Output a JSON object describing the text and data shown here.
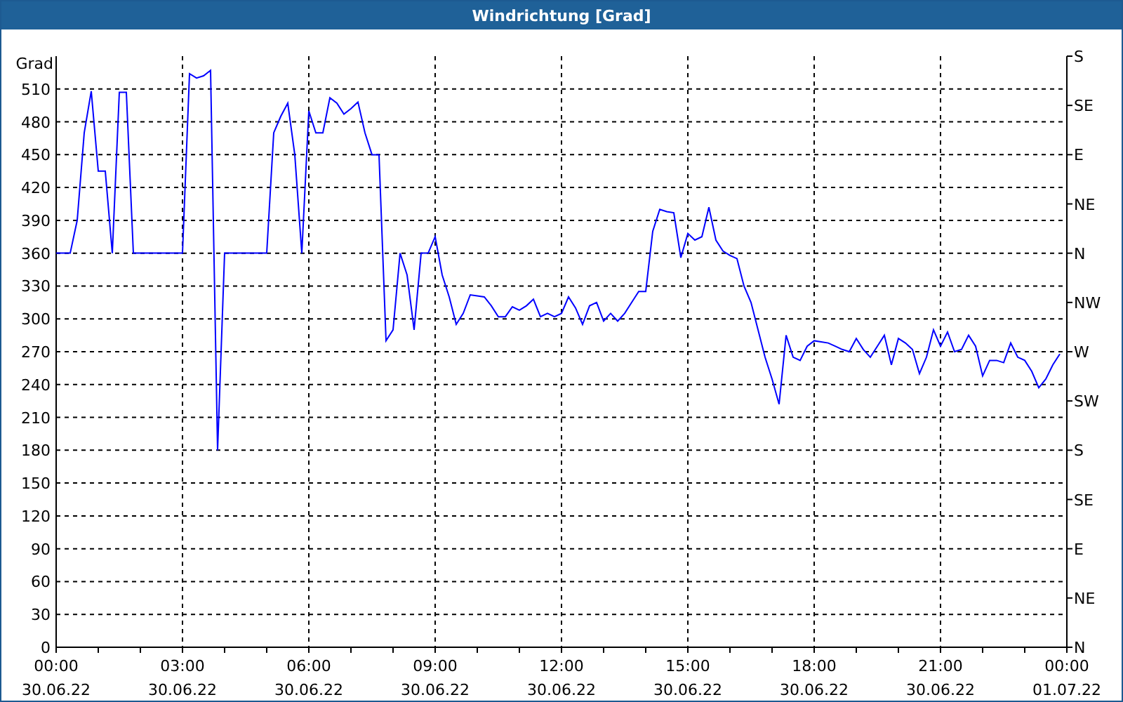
{
  "window": {
    "title": "Windrichtung [Grad]"
  },
  "chart": {
    "chart_data": {
      "type": "line",
      "grid": true,
      "ylabel": "Grad",
      "ylim": [
        0,
        540
      ],
      "yticks": [
        0,
        30,
        60,
        90,
        120,
        150,
        180,
        210,
        240,
        270,
        300,
        330,
        360,
        390,
        420,
        450,
        480,
        510
      ],
      "categories": [
        "00:00\n30.06.22",
        null,
        null,
        null,
        null,
        null,
        null,
        null,
        null,
        null,
        null,
        null,
        null,
        null,
        null,
        null,
        null,
        null,
        "03:00\n30.06.22",
        null,
        null,
        null,
        null,
        null,
        null,
        null,
        null,
        null,
        null,
        null,
        null,
        null,
        null,
        null,
        null,
        null,
        "06:00\n30.06.22",
        null,
        null,
        null,
        null,
        null,
        null,
        null,
        null,
        null,
        null,
        null,
        null,
        null,
        null,
        null,
        null,
        null,
        "09:00\n30.06.22",
        null,
        null,
        null,
        null,
        null,
        null,
        null,
        null,
        null,
        null,
        null,
        null,
        null,
        null,
        null,
        null,
        null,
        "12:00\n30.06.22",
        null,
        null,
        null,
        null,
        null,
        null,
        null,
        null,
        null,
        null,
        null,
        null,
        null,
        null,
        null,
        null,
        null,
        "15:00\n30.06.22",
        null,
        null,
        null,
        null,
        null,
        null,
        null,
        null,
        null,
        null,
        null,
        null,
        null,
        null,
        null,
        null,
        null,
        "18:00\n30.06.22",
        null,
        null,
        null,
        null,
        null,
        null,
        null,
        null,
        null,
        null,
        null,
        null,
        null,
        null,
        null,
        null,
        null,
        "21:00\n30.06.22",
        null,
        null,
        null,
        null,
        null,
        null,
        null,
        null,
        null,
        null,
        null,
        null,
        null,
        null,
        null,
        null,
        null,
        "00:00\n01.07.22"
      ],
      "series": [
        {
          "color": "#0000ff",
          "values": [
            360,
            360,
            360,
            390,
            470,
            508,
            435,
            435,
            360,
            507,
            507,
            360,
            360,
            360,
            360,
            360,
            360,
            360,
            360,
            524,
            520,
            522,
            527,
            180,
            360,
            360,
            360,
            360,
            360,
            360,
            360,
            470,
            485,
            497,
            450,
            360,
            490,
            470,
            470,
            502,
            497,
            487,
            492,
            498,
            470,
            450,
            450,
            280,
            290,
            360,
            340,
            290,
            360,
            360,
            375,
            340,
            320,
            295,
            305,
            322,
            321,
            320,
            312,
            302,
            302,
            311,
            308,
            312,
            318,
            302,
            305,
            302,
            305,
            320,
            310,
            295,
            312,
            315,
            298,
            305,
            298,
            305,
            315,
            325,
            325,
            380,
            400,
            398,
            397,
            356,
            378,
            372,
            375,
            402,
            372,
            362,
            358,
            355,
            330,
            315,
            290,
            265,
            245,
            222,
            285,
            265,
            262,
            275,
            280,
            279,
            278,
            275,
            272,
            270,
            282,
            272,
            265,
            275,
            285,
            258,
            282,
            278,
            272,
            250,
            265,
            290,
            275,
            288,
            270,
            272,
            285,
            275,
            248,
            262,
            262,
            260,
            278,
            265,
            262,
            252,
            237,
            245,
            258,
            268,
            null
          ]
        }
      ]
    },
    "right_axis": [
      "S",
      "SE",
      "E",
      "NE",
      "N",
      "NW",
      "W",
      "SW",
      "S",
      "SE",
      "E",
      "NE",
      "N"
    ]
  }
}
